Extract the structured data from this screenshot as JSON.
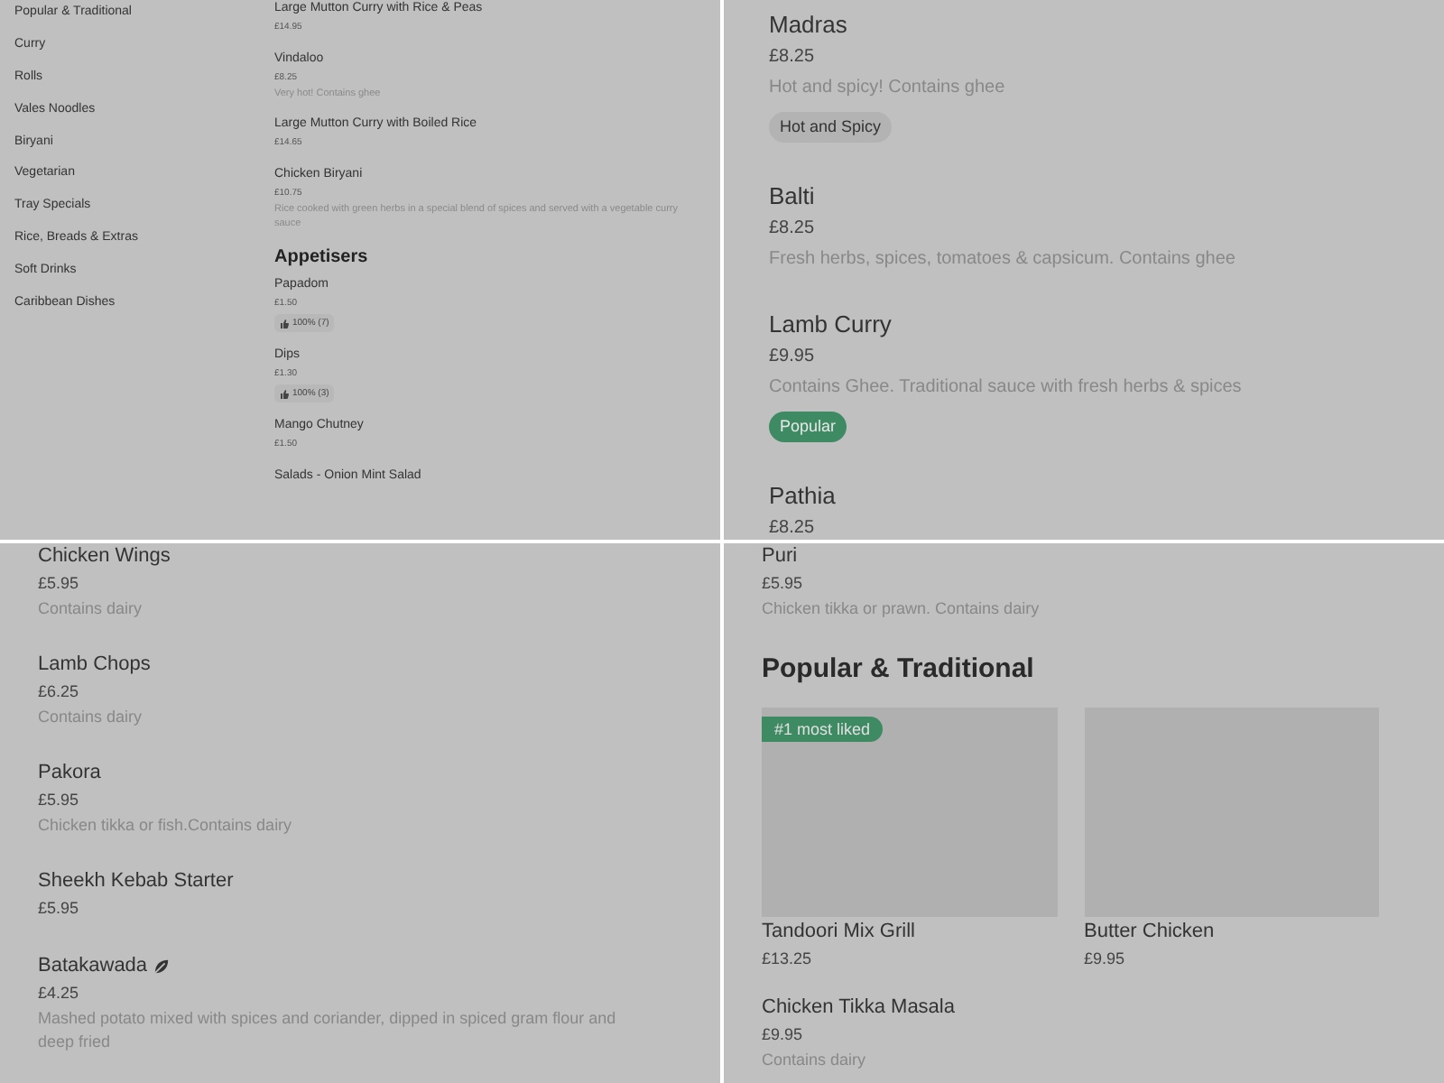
{
  "panels": [
    {
      "kind": "compact",
      "sidebar": {
        "items": [
          {
            "label": "Popular & Traditional"
          },
          {
            "label": "Curry"
          },
          {
            "label": "Rolls"
          },
          {
            "label": "Vales Noodles"
          },
          {
            "label": "Biryani"
          },
          {
            "label": "Vegetarian"
          },
          {
            "label": "Tray Specials"
          },
          {
            "label": "Rice, Breads & Extras"
          },
          {
            "label": "Soft Drinks"
          },
          {
            "label": "Caribbean Dishes"
          }
        ]
      },
      "items": [
        {
          "kind": "dish",
          "name": "Large Mutton Curry with Rice & Peas",
          "price": "£14.95"
        },
        {
          "kind": "dish",
          "name": "Vindaloo",
          "price": "£8.25",
          "description": "Very hot! Contains ghee"
        },
        {
          "kind": "dish",
          "name": "Large Mutton Curry with Boiled Rice",
          "price": "£14.65"
        },
        {
          "kind": "dish",
          "name": "Chicken Biryani",
          "price": "£10.75",
          "description": "Rice cooked with green herbs in a special blend of spices and served with a vegetable curry sauce"
        },
        {
          "kind": "heading",
          "title": "Appetisers"
        },
        {
          "kind": "dish",
          "name": "Papadom",
          "price": "£1.50",
          "rating": "100% (7)"
        },
        {
          "kind": "dish",
          "name": "Dips",
          "price": "£1.30",
          "rating": "100% (3)"
        },
        {
          "kind": "dish",
          "name": "Mango Chutney",
          "price": "£1.50"
        },
        {
          "kind": "dish",
          "name": "Salads - Onion Mint Salad"
        }
      ]
    },
    {
      "kind": "large",
      "items": [
        {
          "kind": "dish",
          "name": "Madras",
          "price": "£8.25",
          "description": "Hot and spicy! Contains ghee",
          "tag": {
            "label": "Hot and Spicy",
            "color": "#b3b3b3"
          }
        },
        {
          "kind": "dish",
          "name": "Balti",
          "price": "£8.25",
          "description": "Fresh herbs, spices, tomatoes & capsicum. Contains ghee"
        },
        {
          "kind": "dish",
          "name": "Lamb Curry",
          "price": "£9.95",
          "description": "Contains Ghee. Traditional sauce with fresh herbs & spices",
          "tag": {
            "label": "Popular",
            "color": "#3d8a63"
          }
        },
        {
          "kind": "dish",
          "name": "Pathia",
          "price": "£8.25"
        }
      ]
    },
    {
      "kind": "medium",
      "items": [
        {
          "kind": "dish",
          "name": "Chicken Wings",
          "price": "£5.95",
          "description": "Contains dairy",
          "vegetarian": false
        },
        {
          "kind": "dish",
          "name": "Lamb Chops",
          "price": "£6.25",
          "description": "Contains dairy",
          "vegetarian": false
        },
        {
          "kind": "dish",
          "name": "Pakora",
          "price": "£5.95",
          "description": "Chicken tikka or fish.Contains dairy",
          "vegetarian": false
        },
        {
          "kind": "dish",
          "name": "Sheekh Kebab Starter",
          "price": "£5.95",
          "vegetarian": false
        },
        {
          "kind": "dish",
          "name": "Batakawada",
          "price": "£4.25",
          "description": "Mashed potato mixed with spices and coriander, dipped in spiced gram flour and deep fried",
          "vegetarian": true
        }
      ]
    },
    {
      "kind": "medium",
      "items": [
        {
          "kind": "dish",
          "name": "Puri",
          "price": "£5.95",
          "description": "Chicken tikka or prawn. Contains dairy"
        },
        {
          "kind": "heading",
          "title": "Popular & Traditional"
        },
        {
          "kind": "cards",
          "cards": [
            {
              "name": "Tandoori Mix Grill",
              "price": "£13.25",
              "badge": "#1 most liked"
            },
            {
              "name": "Butter Chicken",
              "price": "£9.95"
            }
          ]
        },
        {
          "kind": "dish",
          "name": "Chicken Tikka Masala",
          "price": "£9.95",
          "description": "Contains dairy"
        }
      ]
    }
  ]
}
